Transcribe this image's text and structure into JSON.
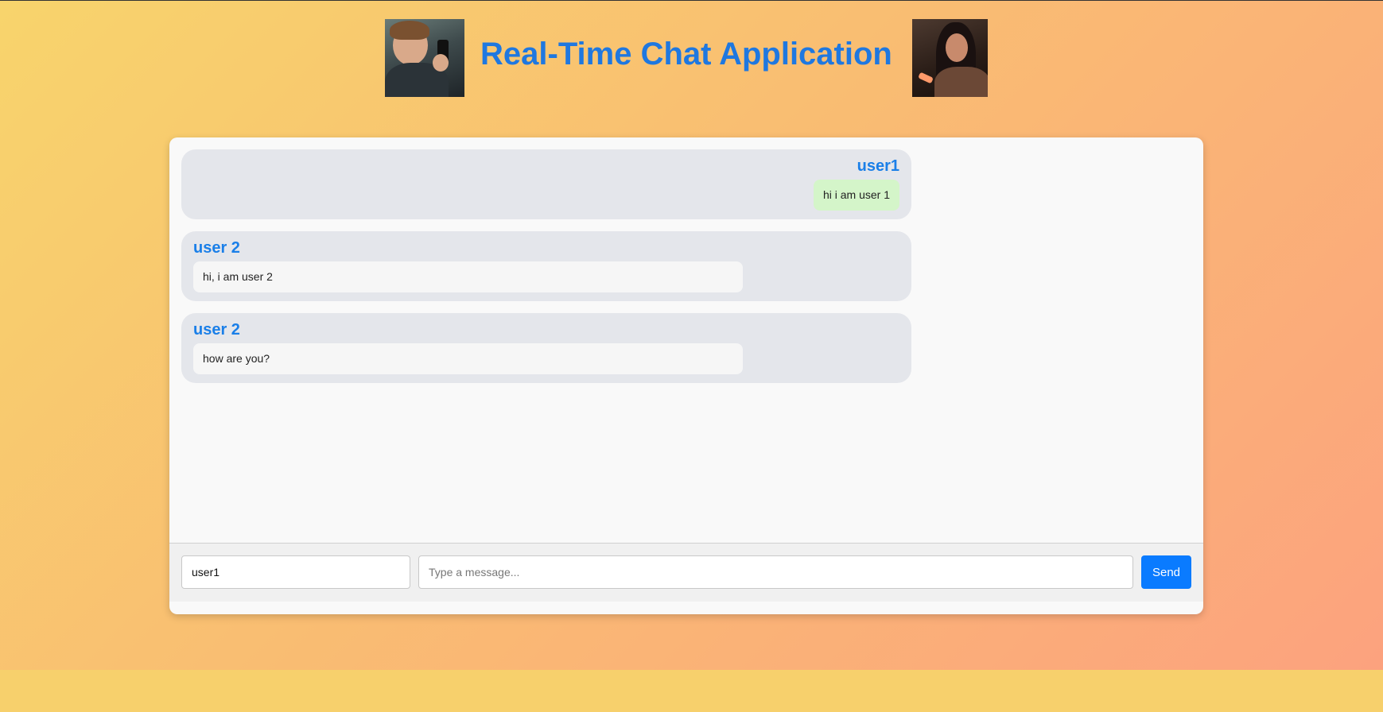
{
  "header": {
    "title": "Real-Time Chat Application",
    "left_avatar_icon": "boy-with-phone-image",
    "right_avatar_icon": "woman-with-phone-image"
  },
  "messages": [
    {
      "sender": "user1",
      "text": "hi i am user 1",
      "self": true
    },
    {
      "sender": "user 2",
      "text": "hi, i am user 2",
      "self": false
    },
    {
      "sender": "user 2",
      "text": "how are you?",
      "self": false
    }
  ],
  "composer": {
    "username_value": "user1",
    "message_placeholder": "Type a message...",
    "send_label": "Send"
  },
  "colors": {
    "accent": "#1a7fe8",
    "send_button": "#0a7bff",
    "self_bubble": "#d4f5c9",
    "message_card": "#e4e6eb"
  }
}
